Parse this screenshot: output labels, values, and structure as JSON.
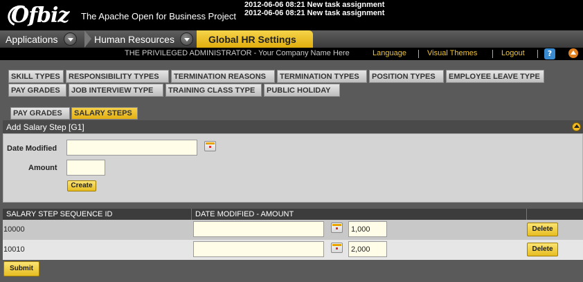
{
  "header": {
    "logo": "Ofbiz",
    "tagline": "The Apache Open for Business Project",
    "notifications": [
      "2012-06-06 08:21 New task assignment",
      "2012-06-06 08:21 New task assignment"
    ]
  },
  "appnav": {
    "applications": "Applications",
    "module": "Human Resources",
    "active": "Global HR Settings"
  },
  "userbar": {
    "user": "THE PRIVILEGED ADMINISTRATOR - Your Company Name Here",
    "language": "Language",
    "themes": "Visual Themes",
    "logout": "Logout",
    "help": "?"
  },
  "submenu_row1": [
    "SKILL TYPES",
    "RESPONSIBILITY TYPES",
    "TERMINATION REASONS",
    "TERMINATION TYPES",
    "POSITION TYPES",
    "EMPLOYEE LEAVE TYPE"
  ],
  "submenu_row2": [
    "PAY GRADES",
    "JOB INTERVIEW TYPE",
    "TRAINING CLASS TYPE",
    "PUBLIC HOLIDAY"
  ],
  "tabs": [
    "PAY GRADES",
    "SALARY STEPS"
  ],
  "form": {
    "title": "Add Salary Step [G1]",
    "date_label": "Date Modified",
    "date_value": "",
    "amount_label": "Amount",
    "amount_value": "",
    "create_label": "Create"
  },
  "table": {
    "headers": [
      "SALARY STEP SEQUENCE ID",
      "DATE MODIFIED - AMOUNT"
    ],
    "rows": [
      {
        "id": "10000",
        "date": "",
        "amount": "1,000",
        "action": "Delete"
      },
      {
        "id": "10010",
        "date": "",
        "amount": "2,000",
        "action": "Delete"
      }
    ]
  },
  "submit_label": "Submit",
  "colors": {
    "accent": "#f1c232",
    "header_bg": "#000000",
    "page_bg": "#5a5a5a"
  }
}
